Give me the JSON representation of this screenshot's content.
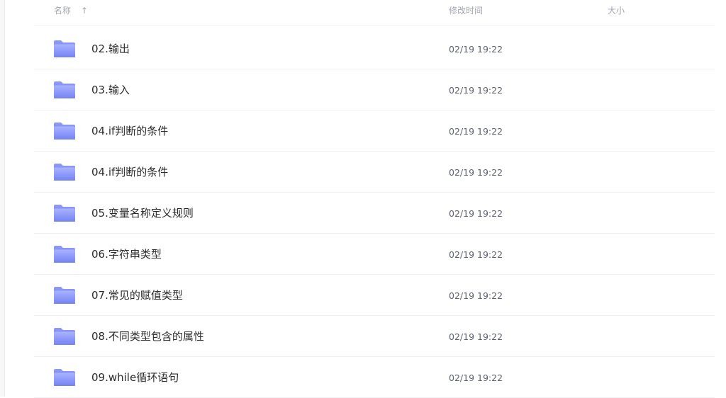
{
  "header": {
    "name_label": "名称",
    "sort_indicator": "↑",
    "time_label": "修改时间",
    "size_label": "大小"
  },
  "icon": "folder-icon",
  "accent": "#7f8cf4",
  "files": [
    {
      "name": "02.输出",
      "modified": "02/19 19:22",
      "size": ""
    },
    {
      "name": "03.输入",
      "modified": "02/19 19:22",
      "size": ""
    },
    {
      "name": "04.if判断的条件",
      "modified": "02/19 19:22",
      "size": ""
    },
    {
      "name": "04.if判断的条件",
      "modified": "02/19 19:22",
      "size": ""
    },
    {
      "name": "05.变量名称定义规则",
      "modified": "02/19 19:22",
      "size": ""
    },
    {
      "name": "06.字符串类型",
      "modified": "02/19 19:22",
      "size": ""
    },
    {
      "name": "07.常见的赋值类型",
      "modified": "02/19 19:22",
      "size": ""
    },
    {
      "name": "08.不同类型包含的属性",
      "modified": "02/19 19:22",
      "size": ""
    },
    {
      "name": "09.while循环语句",
      "modified": "02/19 19:22",
      "size": ""
    }
  ]
}
